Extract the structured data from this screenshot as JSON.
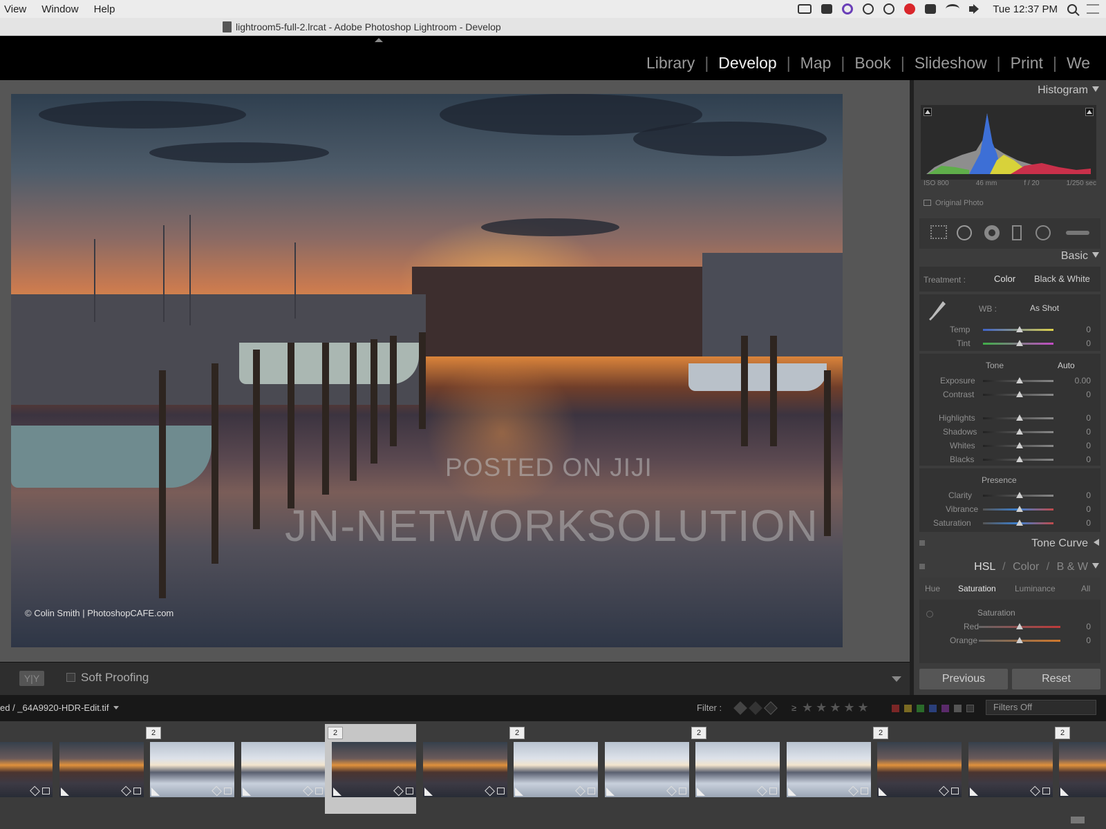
{
  "menubar": {
    "items": [
      "View",
      "Window",
      "Help"
    ],
    "clock": "Tue 12:37 PM"
  },
  "titlebar": {
    "title": "lightroom5-full-2.lrcat - Adobe Photoshop Lightroom - Develop"
  },
  "modules": {
    "items": [
      {
        "label": "Library",
        "active": false
      },
      {
        "label": "Develop",
        "active": true
      },
      {
        "label": "Map",
        "active": false
      },
      {
        "label": "Book",
        "active": false
      },
      {
        "label": "Slideshow",
        "active": false
      },
      {
        "label": "Print",
        "active": false
      },
      {
        "label": "We",
        "active": false
      }
    ]
  },
  "photo": {
    "credit": "© Colin Smith | PhotoshopCAFE.com",
    "watermark_small": "POSTED ON JIJI",
    "watermark_large": "JN-NETWORKSOLUTION"
  },
  "toolbar": {
    "view_toggle": "Y|Y",
    "soft_proofing": "Soft Proofing"
  },
  "histogram": {
    "title": "Histogram",
    "iso": "ISO 800",
    "focal": "46 mm",
    "aperture": "f / 20",
    "shutter": "1/250 sec",
    "original_photo": "Original Photo"
  },
  "basic": {
    "title": "Basic",
    "treatment_label": "Treatment :",
    "treatment_color": "Color",
    "treatment_bw": "Black & White",
    "wb_label": "WB :",
    "wb_value": "As Shot",
    "temp": {
      "label": "Temp",
      "value": "0"
    },
    "tint": {
      "label": "Tint",
      "value": "0"
    },
    "tone_label": "Tone",
    "auto": "Auto",
    "exposure": {
      "label": "Exposure",
      "value": "0.00"
    },
    "contrast": {
      "label": "Contrast",
      "value": "0"
    },
    "highlights": {
      "label": "Highlights",
      "value": "0"
    },
    "shadows": {
      "label": "Shadows",
      "value": "0"
    },
    "whites": {
      "label": "Whites",
      "value": "0"
    },
    "blacks": {
      "label": "Blacks",
      "value": "0"
    },
    "presence_label": "Presence",
    "clarity": {
      "label": "Clarity",
      "value": "0"
    },
    "vibrance": {
      "label": "Vibrance",
      "value": "0"
    },
    "saturation": {
      "label": "Saturation",
      "value": "0"
    }
  },
  "tone_curve": {
    "title": "Tone Curve"
  },
  "hsl": {
    "title_hsl": "HSL",
    "sep": "/",
    "title_color": "Color",
    "title_bw": "B & W",
    "tab_hue": "Hue",
    "tab_saturation": "Saturation",
    "tab_luminance": "Luminance",
    "tab_all": "All",
    "group": "Saturation",
    "red": {
      "label": "Red",
      "value": "0"
    },
    "orange": {
      "label": "Orange",
      "value": "0"
    }
  },
  "buttons": {
    "previous": "Previous",
    "reset": "Reset"
  },
  "filterbar": {
    "path": "ed / _64A9920-HDR-Edit.tif",
    "filter_label": "Filter :",
    "rating_op": "≥",
    "stars": "★★★★★",
    "filters_off": "Filters Off"
  },
  "filmstrip": {
    "cells": [
      {
        "tone": "dark",
        "count": "",
        "selected": false
      },
      {
        "tone": "dark",
        "count": "",
        "selected": false
      },
      {
        "tone": "light",
        "count": "2",
        "selected": false
      },
      {
        "tone": "light",
        "count": "",
        "selected": false
      },
      {
        "tone": "dark",
        "count": "2",
        "selected": true
      },
      {
        "tone": "dark",
        "count": "",
        "selected": false
      },
      {
        "tone": "light",
        "count": "2",
        "selected": false
      },
      {
        "tone": "light",
        "count": "",
        "selected": false
      },
      {
        "tone": "light",
        "count": "2",
        "selected": false
      },
      {
        "tone": "light",
        "count": "",
        "selected": false
      },
      {
        "tone": "dark",
        "count": "2",
        "selected": false
      },
      {
        "tone": "dark",
        "count": "",
        "selected": false
      },
      {
        "tone": "dark",
        "count": "2",
        "selected": false
      }
    ]
  },
  "colors": {
    "panel_bg": "#3c3c3c",
    "module_active": "#f2f2f2",
    "module_inactive": "#9a9a9a"
  }
}
